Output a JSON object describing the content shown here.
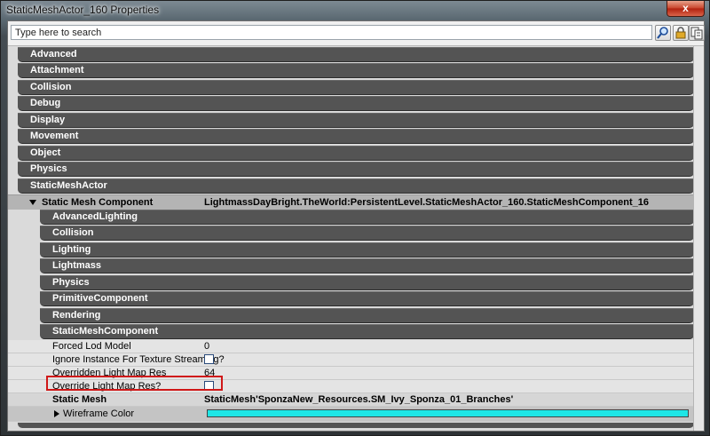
{
  "window": {
    "title": "StaticMeshActor_160 Properties",
    "close_glyph": "x"
  },
  "search": {
    "placeholder": "Type here to search",
    "value": ""
  },
  "toolbar": {
    "icons": [
      "magnifier-icon",
      "lock-icon",
      "copy-icon"
    ]
  },
  "top_categories": [
    "Advanced",
    "Attachment",
    "Collision",
    "Debug",
    "Display",
    "Movement",
    "Object",
    "Physics",
    "StaticMeshActor"
  ],
  "component": {
    "label": "Static Mesh Component",
    "value": "LightmassDayBright.TheWorld:PersistentLevel.StaticMeshActor_160.StaticMeshComponent_16",
    "sub_categories": [
      "AdvancedLighting",
      "Collision",
      "Lighting",
      "Lightmass",
      "Physics",
      "PrimitiveComponent",
      "Rendering",
      "StaticMeshComponent"
    ]
  },
  "properties": [
    {
      "name": "Forced Lod Model",
      "value": "0"
    },
    {
      "name": "Ignore Instance For Texture Streaming?",
      "checked": false
    },
    {
      "name": "Overridden Light Map Res",
      "value": "64"
    },
    {
      "name": "Override Light Map Res?",
      "checked": false
    }
  ],
  "static_mesh": {
    "label": "Static Mesh",
    "value": "StaticMesh'SponzaNew_Resources.SM_Ivy_Sponza_01_Branches'"
  },
  "wireframe": {
    "label": "Wireframe Color",
    "color": "#1ee6e6"
  }
}
